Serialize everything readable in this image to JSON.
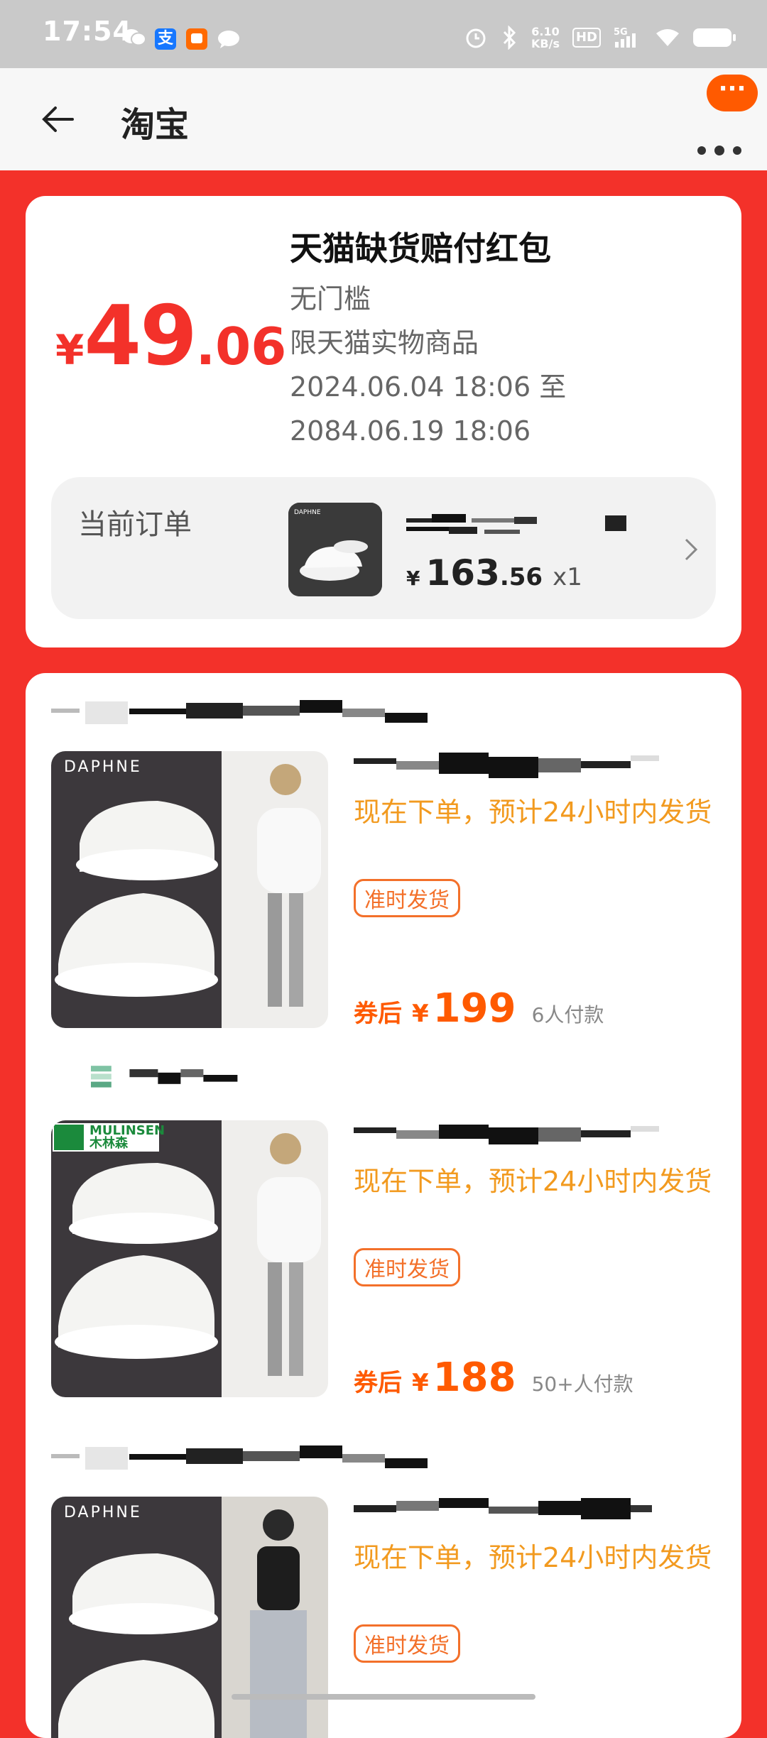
{
  "status_bar": {
    "time": "17:54",
    "net_speed_value": "6.10",
    "net_speed_unit": "KB/s",
    "hd": "HD",
    "signal": "5G"
  },
  "navbar": {
    "title": "淘宝",
    "fab_label": "···"
  },
  "coupon": {
    "currency": "¥",
    "amount_int": "49",
    "amount_dec": ".06",
    "title": "天猫缺货赔付红包",
    "threshold": "无门槛",
    "scope": "限天猫实物商品",
    "valid_from": "2024.06.04 18:06 至",
    "valid_to": "2084.06.19 18:06"
  },
  "order": {
    "label": "当前订单",
    "thumb_brand": "DAPHNE",
    "currency": "¥",
    "price_int": "163",
    "price_dec": ".56",
    "qty": "x1"
  },
  "products": [
    {
      "brand": "DAPHNE",
      "ship": "现在下单，预计24小时内发货",
      "badge": "准时发货",
      "price_label": "券后",
      "currency": "¥",
      "price": "199",
      "sold": "6人付款"
    },
    {
      "brand": "MULINSEN 木林森",
      "ship": "现在下单，预计24小时内发货",
      "badge": "准时发货",
      "price_label": "券后",
      "currency": "¥",
      "price": "188",
      "sold": "50+人付款"
    },
    {
      "brand": "DAPHNE",
      "ship": "现在下单，预计24小时内发货",
      "badge": "准时发货"
    }
  ],
  "colors": {
    "page_bg": "#f3312a",
    "price": "#ff5a00",
    "ship_text": "#f29a1f"
  }
}
